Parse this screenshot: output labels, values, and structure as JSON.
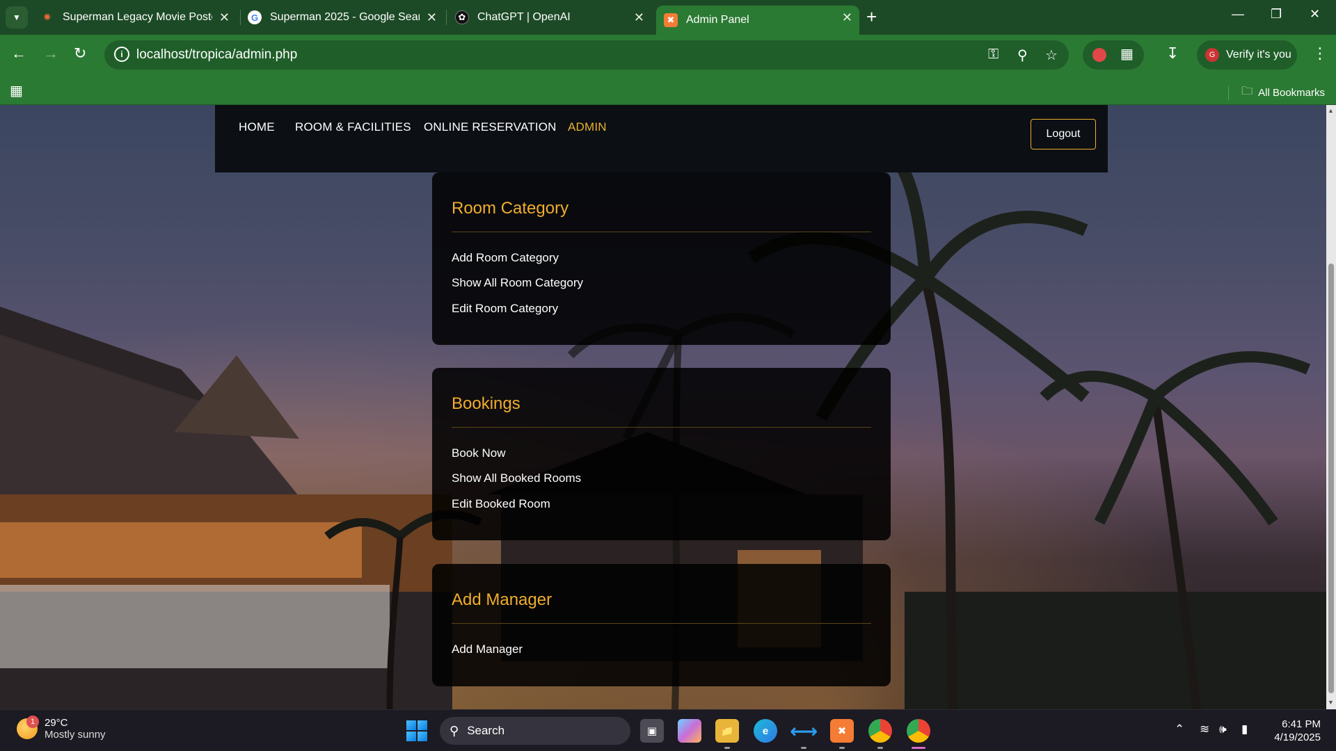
{
  "browser": {
    "tabs": [
      {
        "title": "Superman Legacy Movie Poster",
        "active": false
      },
      {
        "title": "Superman 2025 - Google Search",
        "active": false
      },
      {
        "title": "ChatGPT | OpenAI",
        "active": false
      },
      {
        "title": "Admin Panel",
        "active": true
      }
    ],
    "url": "localhost/tropica/admin.php",
    "verify_label": "Verify it's you",
    "all_bookmarks": "All Bookmarks",
    "theme_color": "#2b7a33"
  },
  "site": {
    "nav": {
      "items": [
        "HOME",
        "ROOM & FACILITIES",
        "ONLINE RESERVATION",
        "ADMIN"
      ],
      "active": "ADMIN",
      "logout": "Logout"
    },
    "accent_color": "#f0ad2e",
    "cards": [
      {
        "title": "Room Category",
        "items": [
          "Add Room Category",
          "Show All Room Category",
          "Edit Room Category"
        ]
      },
      {
        "title": "Bookings",
        "items": [
          "Book Now",
          "Show All Booked Rooms",
          "Edit Booked Room"
        ]
      },
      {
        "title": "Add Manager",
        "items": [
          "Add Manager"
        ]
      }
    ]
  },
  "taskbar": {
    "weather": {
      "temp": "29°C",
      "condition": "Mostly sunny",
      "badge": "1"
    },
    "search_placeholder": "Search",
    "time": "6:41 PM",
    "date": "4/19/2025"
  }
}
